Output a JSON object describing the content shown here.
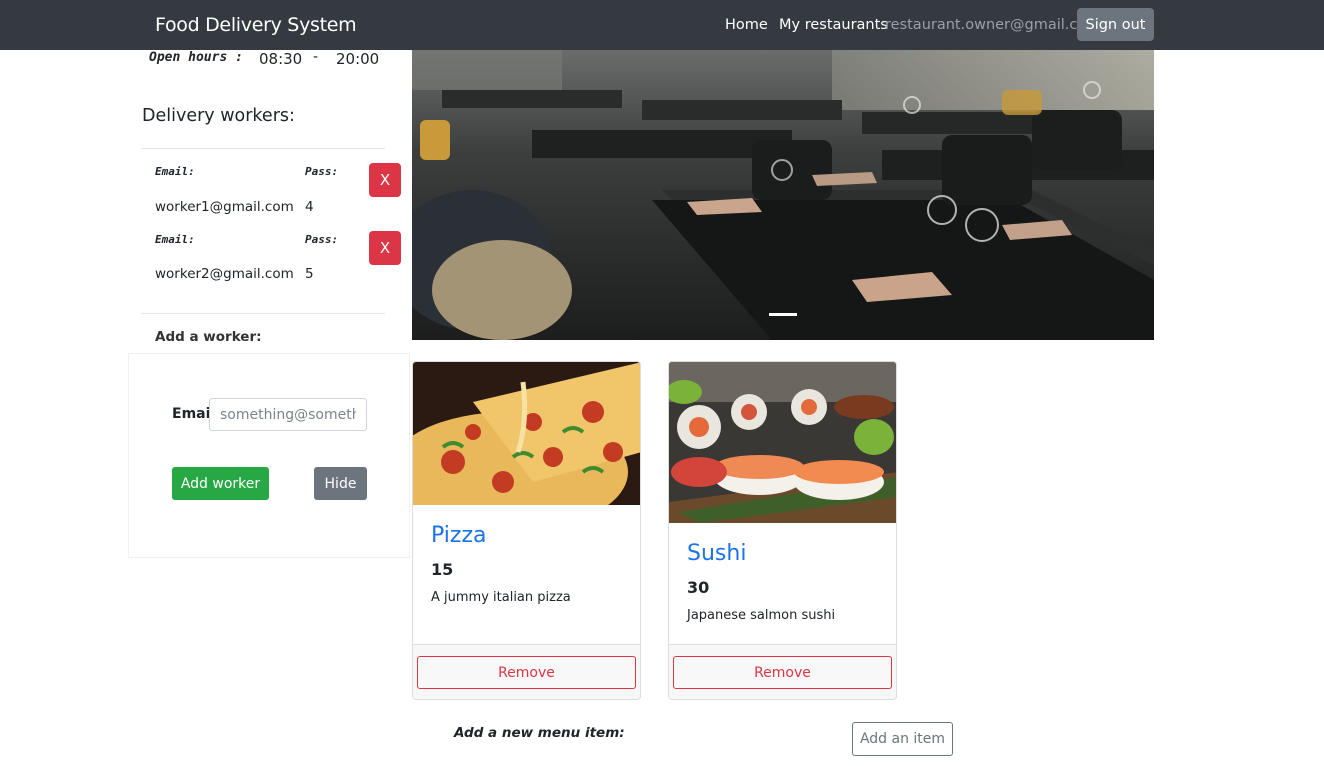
{
  "navbar": {
    "brand": "Food Delivery System",
    "home": "Home",
    "my_restaurants": "My restaurants",
    "user_email": "restaurant.owner@gmail.com",
    "sign_out": "Sign out"
  },
  "hours": {
    "label": "Open hours :",
    "from": "08:30",
    "separator": "-",
    "to": "20:00"
  },
  "workers": {
    "title": "Delivery workers:",
    "email_label": "Email:",
    "pass_label": "Pass:",
    "remove_label": "X",
    "items": [
      {
        "email": "worker1@gmail.com",
        "pass": "4"
      },
      {
        "email": "worker2@gmail.com",
        "pass": "5"
      }
    ]
  },
  "add_worker": {
    "title": "Add a worker:",
    "email_label": "Email",
    "email_placeholder": "something@something.com",
    "submit": "Add worker",
    "hide": "Hide"
  },
  "menu": {
    "items": [
      {
        "name": "Pizza",
        "price": "15",
        "description": "A jummy italian pizza",
        "remove": "Remove"
      },
      {
        "name": "Sushi",
        "price": "30",
        "description": "Japanese salmon sushi",
        "remove": "Remove"
      }
    ],
    "add_label": "Add a new menu item:",
    "add_button": "Add an item"
  },
  "colors": {
    "navbar": "#343a40",
    "danger": "#dc3545",
    "success": "#28a745",
    "secondary": "#6c757d",
    "link": "#1a73e8"
  }
}
